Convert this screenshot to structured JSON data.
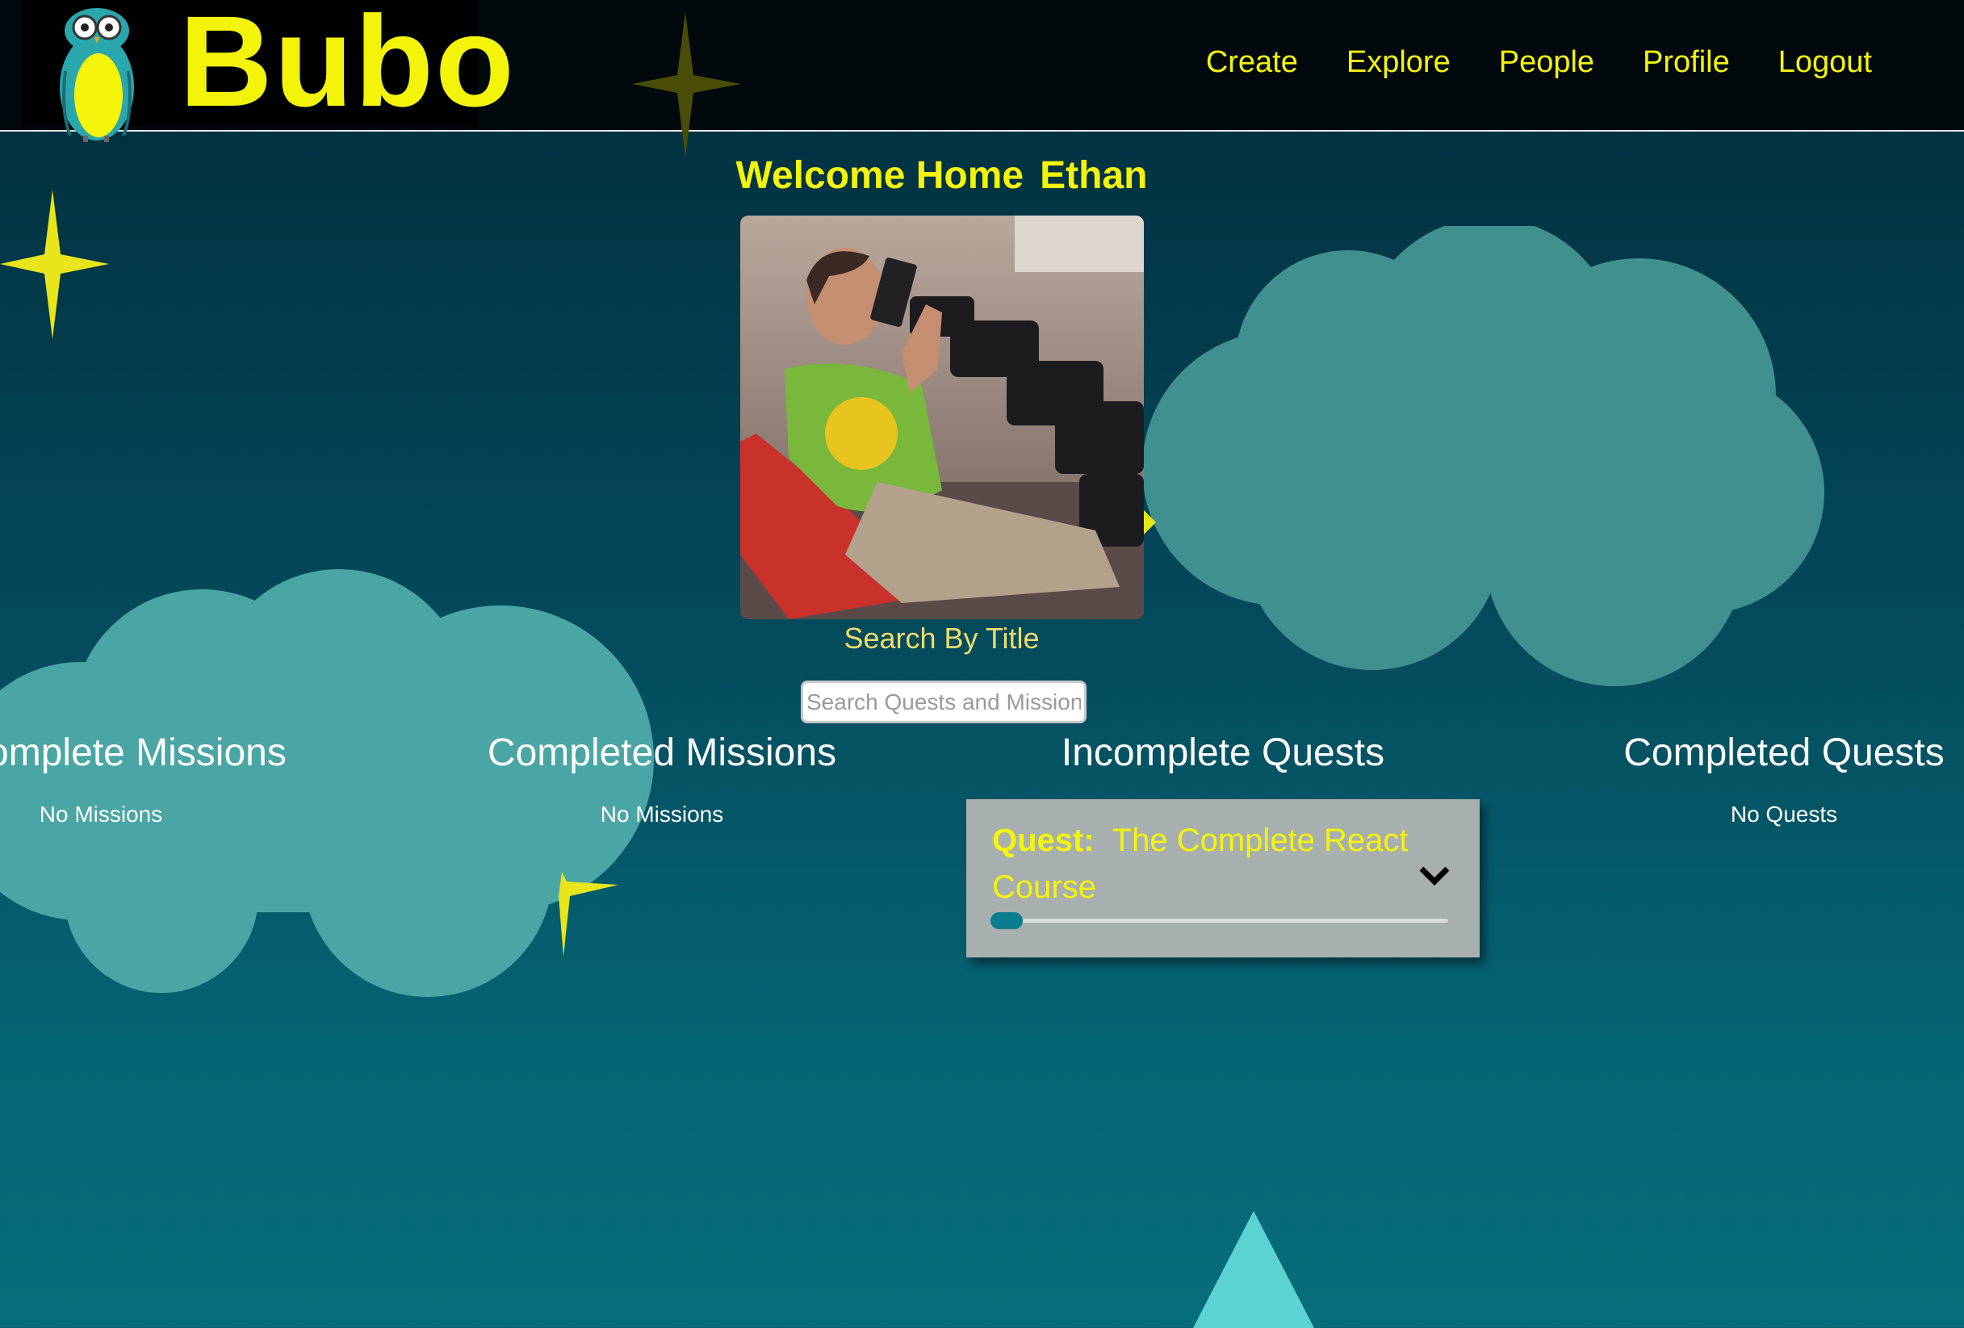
{
  "app": {
    "logo_text": "Bubo"
  },
  "nav": {
    "items": [
      {
        "label": "Create",
        "name": "nav-create"
      },
      {
        "label": "Explore",
        "name": "nav-explore"
      },
      {
        "label": "People",
        "name": "nav-people"
      },
      {
        "label": "Profile",
        "name": "nav-profile"
      },
      {
        "label": "Logout",
        "name": "nav-logout"
      }
    ]
  },
  "welcome": {
    "greeting": "Welcome Home",
    "user_name": "Ethan"
  },
  "search": {
    "label": "Search By Title",
    "placeholder": "Search Quests and Missions"
  },
  "columns": {
    "incomplete_missions": {
      "title": "Incomplete Missions",
      "empty": "No Missions"
    },
    "completed_missions": {
      "title": "Completed Missions",
      "empty": "No Missions"
    },
    "incomplete_quests": {
      "title": "Incomplete Quests"
    },
    "completed_quests": {
      "title": "Completed Quests",
      "empty": "No Quests"
    }
  },
  "quest_card": {
    "label": "Quest:",
    "title": "The Complete React Course",
    "progress_fraction": 0.07
  },
  "colors": {
    "accent": "#f4f40a",
    "header_bg": "#01090c",
    "cloud": "#4aa5a5",
    "card_bg": "#a7b0ae",
    "progress": "#0a7d8f"
  }
}
